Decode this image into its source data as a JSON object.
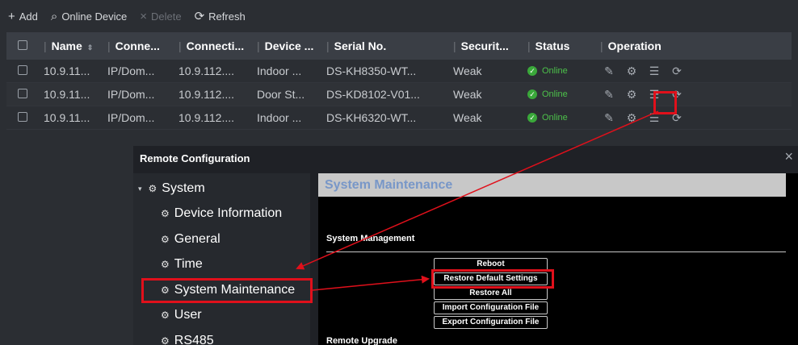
{
  "toolbar": {
    "add": {
      "icon": "+",
      "label": "Add"
    },
    "online_device": {
      "icon": "⌕",
      "label": "Online Device"
    },
    "delete": {
      "icon": "×",
      "label": "Delete"
    },
    "refresh": {
      "icon": "⟳",
      "label": "Refresh"
    }
  },
  "table": {
    "headers": [
      "Name",
      "Conne...",
      "Connecti...",
      "Device ...",
      "Serial No.",
      "Securit...",
      "Status",
      "Operation"
    ],
    "rows": [
      {
        "name": "10.9.11...",
        "conn": "IP/Dom...",
        "addr": "10.9.112....",
        "device": "Indoor ...",
        "serial": "DS-KH8350-WT...",
        "security": "Weak",
        "status": "Online"
      },
      {
        "name": "10.9.11...",
        "conn": "IP/Dom...",
        "addr": "10.9.112....",
        "device": "Door St...",
        "serial": "DS-KD8102-V01...",
        "security": "Weak",
        "status": "Online"
      },
      {
        "name": "10.9.11...",
        "conn": "IP/Dom...",
        "addr": "10.9.112....",
        "device": "Indoor ...",
        "serial": "DS-KH6320-WT...",
        "security": "Weak",
        "status": "Online"
      }
    ]
  },
  "panel": {
    "title": "Remote Configuration",
    "close": "×",
    "tree": {
      "root": "System",
      "items": [
        "Device Information",
        "General",
        "Time",
        "System Maintenance",
        "User",
        "RS485"
      ]
    },
    "content": {
      "header": "System Maintenance",
      "section_management": "System Management",
      "buttons": [
        "Reboot",
        "Restore Default Settings",
        "Restore All",
        "Import Configuration File",
        "Export Configuration File"
      ],
      "section_upgrade": "Remote Upgrade"
    }
  },
  "colors": {
    "highlight": "#e0101b",
    "online": "#4cc14a",
    "header_blue": "#7897c8"
  }
}
